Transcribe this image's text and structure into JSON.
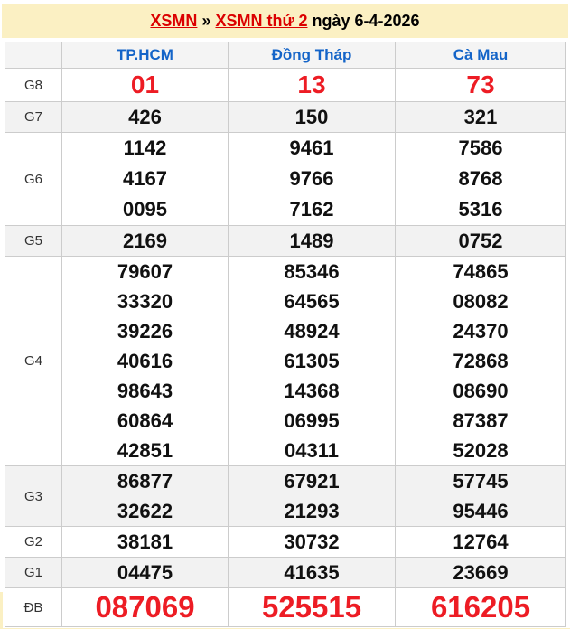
{
  "colors": {
    "band_yellow": "#fbf0c3",
    "title_link_red": "#db0000",
    "number_red": "#ed1c24",
    "column_link_blue": "#1464c8",
    "alt_row_gray": "#f2f2f2",
    "header_row_gray": "#f4f4f4",
    "border_gray": "#cccccc"
  },
  "header": {
    "link1": "XSMN",
    "separator": "»",
    "link2": "XSMN thứ 2",
    "date_text": "ngày 6-4-2026"
  },
  "table": {
    "columns": [
      "TP.HCM",
      "Đồng Tháp",
      "Cà Mau"
    ],
    "rows": [
      {
        "label": "G8",
        "size": "g8",
        "values": [
          [
            "01"
          ],
          [
            "13"
          ],
          [
            "73"
          ]
        ]
      },
      {
        "label": "G7",
        "size": "normal",
        "values": [
          [
            "426"
          ],
          [
            "150"
          ],
          [
            "321"
          ]
        ]
      },
      {
        "label": "G6",
        "size": "g6",
        "values": [
          [
            "1142",
            "4167",
            "0095"
          ],
          [
            "9461",
            "9766",
            "7162"
          ],
          [
            "7586",
            "8768",
            "5316"
          ]
        ]
      },
      {
        "label": "G5",
        "size": "normal",
        "values": [
          [
            "2169"
          ],
          [
            "1489"
          ],
          [
            "0752"
          ]
        ]
      },
      {
        "label": "G4",
        "size": "g4",
        "values": [
          [
            "79607",
            "33320",
            "39226",
            "40616",
            "98643",
            "60864",
            "42851"
          ],
          [
            "85346",
            "64565",
            "48924",
            "61305",
            "14368",
            "06995",
            "04311"
          ],
          [
            "74865",
            "08082",
            "24370",
            "72868",
            "08690",
            "87387",
            "52028"
          ]
        ]
      },
      {
        "label": "G3",
        "size": "g3",
        "values": [
          [
            "86877",
            "32622"
          ],
          [
            "67921",
            "21293"
          ],
          [
            "57745",
            "95446"
          ]
        ]
      },
      {
        "label": "G2",
        "size": "normal",
        "values": [
          [
            "38181"
          ],
          [
            "30732"
          ],
          [
            "12764"
          ]
        ]
      },
      {
        "label": "G1",
        "size": "normal",
        "values": [
          [
            "04475"
          ],
          [
            "41635"
          ],
          [
            "23669"
          ]
        ]
      },
      {
        "label": "ĐB",
        "size": "db",
        "values": [
          [
            "087069"
          ],
          [
            "525515"
          ],
          [
            "616205"
          ]
        ]
      }
    ]
  }
}
